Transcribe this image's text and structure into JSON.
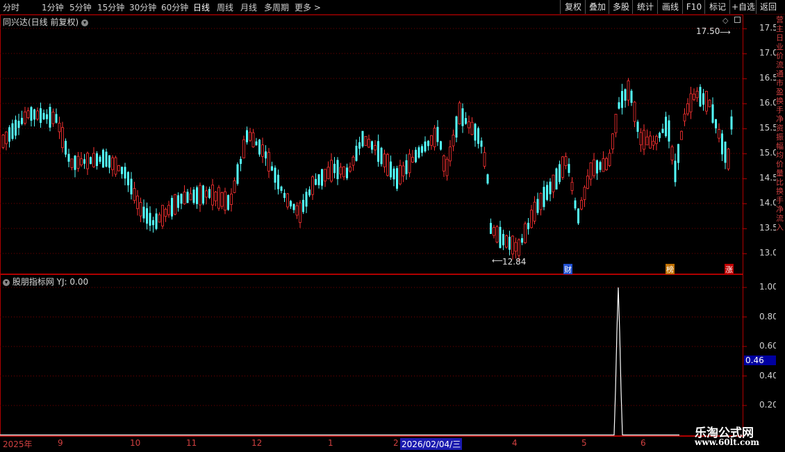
{
  "toolbar": {
    "periods": [
      "分时",
      "1分钟",
      "5分钟",
      "15分钟",
      "30分钟",
      "60分钟",
      "日线",
      "周线",
      "月线",
      "多周期",
      "更多 >"
    ],
    "active_period": "日线",
    "actions": [
      "复权",
      "叠加",
      "多股",
      "统计",
      "画线",
      "F10",
      "标记",
      "+自选",
      "返回"
    ]
  },
  "main_panel": {
    "title": "同兴达(日线 前复权)",
    "y_ticks": [
      "17.50",
      "17.00",
      "16.50",
      "16.00",
      "15.50",
      "15.00",
      "14.50",
      "14.00",
      "13.50",
      "13.00"
    ],
    "high_label": "17.50",
    "low_label": "12.84",
    "badges": [
      {
        "text": "财",
        "color": "#1f4fd0"
      },
      {
        "text": "榜",
        "color": "#c07000"
      },
      {
        "text": "涨",
        "color": "#c00000"
      }
    ]
  },
  "indicator_panel": {
    "title": "股朋指标网",
    "series_label": "YJ: 0.00",
    "y_ticks": [
      "1.00",
      "0.80",
      "0.60",
      "0.40",
      "0.20"
    ],
    "current_value": "0.46"
  },
  "x_axis": {
    "labels": [
      "2025年",
      "9",
      "10",
      "11",
      "12",
      "1",
      "2",
      "4",
      "5",
      "6"
    ],
    "cursor_date": "2026/02/04/三"
  },
  "watermark": {
    "line1": "乐淘公式网",
    "line2": "www.60lt.com"
  },
  "right_strip_text": "营 主 日 业 价 流 通 市 盈 换 手 净 资 振 幅 均 价 量 比 换 手 净 流 入",
  "colors": {
    "up": "#ff3232",
    "down": "#54ffff",
    "grid": "#7a0000",
    "border": "#b00000"
  },
  "chart_data": {
    "type": "candlestick",
    "price_range": [
      12.8,
      17.6
    ],
    "indicator": {
      "name": "YJ",
      "values_peak": 1.0,
      "current": 0.0
    }
  }
}
